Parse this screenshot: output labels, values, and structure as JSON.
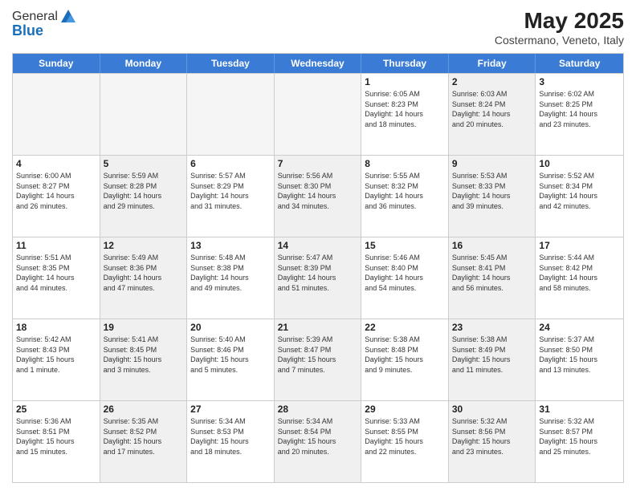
{
  "logo": {
    "general": "General",
    "blue": "Blue"
  },
  "header": {
    "month": "May 2025",
    "location": "Costermano, Veneto, Italy"
  },
  "weekdays": [
    "Sunday",
    "Monday",
    "Tuesday",
    "Wednesday",
    "Thursday",
    "Friday",
    "Saturday"
  ],
  "rows": [
    [
      {
        "day": "",
        "info": "",
        "empty": true
      },
      {
        "day": "",
        "info": "",
        "empty": true
      },
      {
        "day": "",
        "info": "",
        "empty": true
      },
      {
        "day": "",
        "info": "",
        "empty": true
      },
      {
        "day": "1",
        "info": "Sunrise: 6:05 AM\nSunset: 8:23 PM\nDaylight: 14 hours\nand 18 minutes.",
        "empty": false,
        "shaded": false
      },
      {
        "day": "2",
        "info": "Sunrise: 6:03 AM\nSunset: 8:24 PM\nDaylight: 14 hours\nand 20 minutes.",
        "empty": false,
        "shaded": true
      },
      {
        "day": "3",
        "info": "Sunrise: 6:02 AM\nSunset: 8:25 PM\nDaylight: 14 hours\nand 23 minutes.",
        "empty": false,
        "shaded": false
      }
    ],
    [
      {
        "day": "4",
        "info": "Sunrise: 6:00 AM\nSunset: 8:27 PM\nDaylight: 14 hours\nand 26 minutes.",
        "empty": false,
        "shaded": false
      },
      {
        "day": "5",
        "info": "Sunrise: 5:59 AM\nSunset: 8:28 PM\nDaylight: 14 hours\nand 29 minutes.",
        "empty": false,
        "shaded": true
      },
      {
        "day": "6",
        "info": "Sunrise: 5:57 AM\nSunset: 8:29 PM\nDaylight: 14 hours\nand 31 minutes.",
        "empty": false,
        "shaded": false
      },
      {
        "day": "7",
        "info": "Sunrise: 5:56 AM\nSunset: 8:30 PM\nDaylight: 14 hours\nand 34 minutes.",
        "empty": false,
        "shaded": true
      },
      {
        "day": "8",
        "info": "Sunrise: 5:55 AM\nSunset: 8:32 PM\nDaylight: 14 hours\nand 36 minutes.",
        "empty": false,
        "shaded": false
      },
      {
        "day": "9",
        "info": "Sunrise: 5:53 AM\nSunset: 8:33 PM\nDaylight: 14 hours\nand 39 minutes.",
        "empty": false,
        "shaded": true
      },
      {
        "day": "10",
        "info": "Sunrise: 5:52 AM\nSunset: 8:34 PM\nDaylight: 14 hours\nand 42 minutes.",
        "empty": false,
        "shaded": false
      }
    ],
    [
      {
        "day": "11",
        "info": "Sunrise: 5:51 AM\nSunset: 8:35 PM\nDaylight: 14 hours\nand 44 minutes.",
        "empty": false,
        "shaded": false
      },
      {
        "day": "12",
        "info": "Sunrise: 5:49 AM\nSunset: 8:36 PM\nDaylight: 14 hours\nand 47 minutes.",
        "empty": false,
        "shaded": true
      },
      {
        "day": "13",
        "info": "Sunrise: 5:48 AM\nSunset: 8:38 PM\nDaylight: 14 hours\nand 49 minutes.",
        "empty": false,
        "shaded": false
      },
      {
        "day": "14",
        "info": "Sunrise: 5:47 AM\nSunset: 8:39 PM\nDaylight: 14 hours\nand 51 minutes.",
        "empty": false,
        "shaded": true
      },
      {
        "day": "15",
        "info": "Sunrise: 5:46 AM\nSunset: 8:40 PM\nDaylight: 14 hours\nand 54 minutes.",
        "empty": false,
        "shaded": false
      },
      {
        "day": "16",
        "info": "Sunrise: 5:45 AM\nSunset: 8:41 PM\nDaylight: 14 hours\nand 56 minutes.",
        "empty": false,
        "shaded": true
      },
      {
        "day": "17",
        "info": "Sunrise: 5:44 AM\nSunset: 8:42 PM\nDaylight: 14 hours\nand 58 minutes.",
        "empty": false,
        "shaded": false
      }
    ],
    [
      {
        "day": "18",
        "info": "Sunrise: 5:42 AM\nSunset: 8:43 PM\nDaylight: 15 hours\nand 1 minute.",
        "empty": false,
        "shaded": false
      },
      {
        "day": "19",
        "info": "Sunrise: 5:41 AM\nSunset: 8:45 PM\nDaylight: 15 hours\nand 3 minutes.",
        "empty": false,
        "shaded": true
      },
      {
        "day": "20",
        "info": "Sunrise: 5:40 AM\nSunset: 8:46 PM\nDaylight: 15 hours\nand 5 minutes.",
        "empty": false,
        "shaded": false
      },
      {
        "day": "21",
        "info": "Sunrise: 5:39 AM\nSunset: 8:47 PM\nDaylight: 15 hours\nand 7 minutes.",
        "empty": false,
        "shaded": true
      },
      {
        "day": "22",
        "info": "Sunrise: 5:38 AM\nSunset: 8:48 PM\nDaylight: 15 hours\nand 9 minutes.",
        "empty": false,
        "shaded": false
      },
      {
        "day": "23",
        "info": "Sunrise: 5:38 AM\nSunset: 8:49 PM\nDaylight: 15 hours\nand 11 minutes.",
        "empty": false,
        "shaded": true
      },
      {
        "day": "24",
        "info": "Sunrise: 5:37 AM\nSunset: 8:50 PM\nDaylight: 15 hours\nand 13 minutes.",
        "empty": false,
        "shaded": false
      }
    ],
    [
      {
        "day": "25",
        "info": "Sunrise: 5:36 AM\nSunset: 8:51 PM\nDaylight: 15 hours\nand 15 minutes.",
        "empty": false,
        "shaded": false
      },
      {
        "day": "26",
        "info": "Sunrise: 5:35 AM\nSunset: 8:52 PM\nDaylight: 15 hours\nand 17 minutes.",
        "empty": false,
        "shaded": true
      },
      {
        "day": "27",
        "info": "Sunrise: 5:34 AM\nSunset: 8:53 PM\nDaylight: 15 hours\nand 18 minutes.",
        "empty": false,
        "shaded": false
      },
      {
        "day": "28",
        "info": "Sunrise: 5:34 AM\nSunset: 8:54 PM\nDaylight: 15 hours\nand 20 minutes.",
        "empty": false,
        "shaded": true
      },
      {
        "day": "29",
        "info": "Sunrise: 5:33 AM\nSunset: 8:55 PM\nDaylight: 15 hours\nand 22 minutes.",
        "empty": false,
        "shaded": false
      },
      {
        "day": "30",
        "info": "Sunrise: 5:32 AM\nSunset: 8:56 PM\nDaylight: 15 hours\nand 23 minutes.",
        "empty": false,
        "shaded": true
      },
      {
        "day": "31",
        "info": "Sunrise: 5:32 AM\nSunset: 8:57 PM\nDaylight: 15 hours\nand 25 minutes.",
        "empty": false,
        "shaded": false
      }
    ]
  ]
}
